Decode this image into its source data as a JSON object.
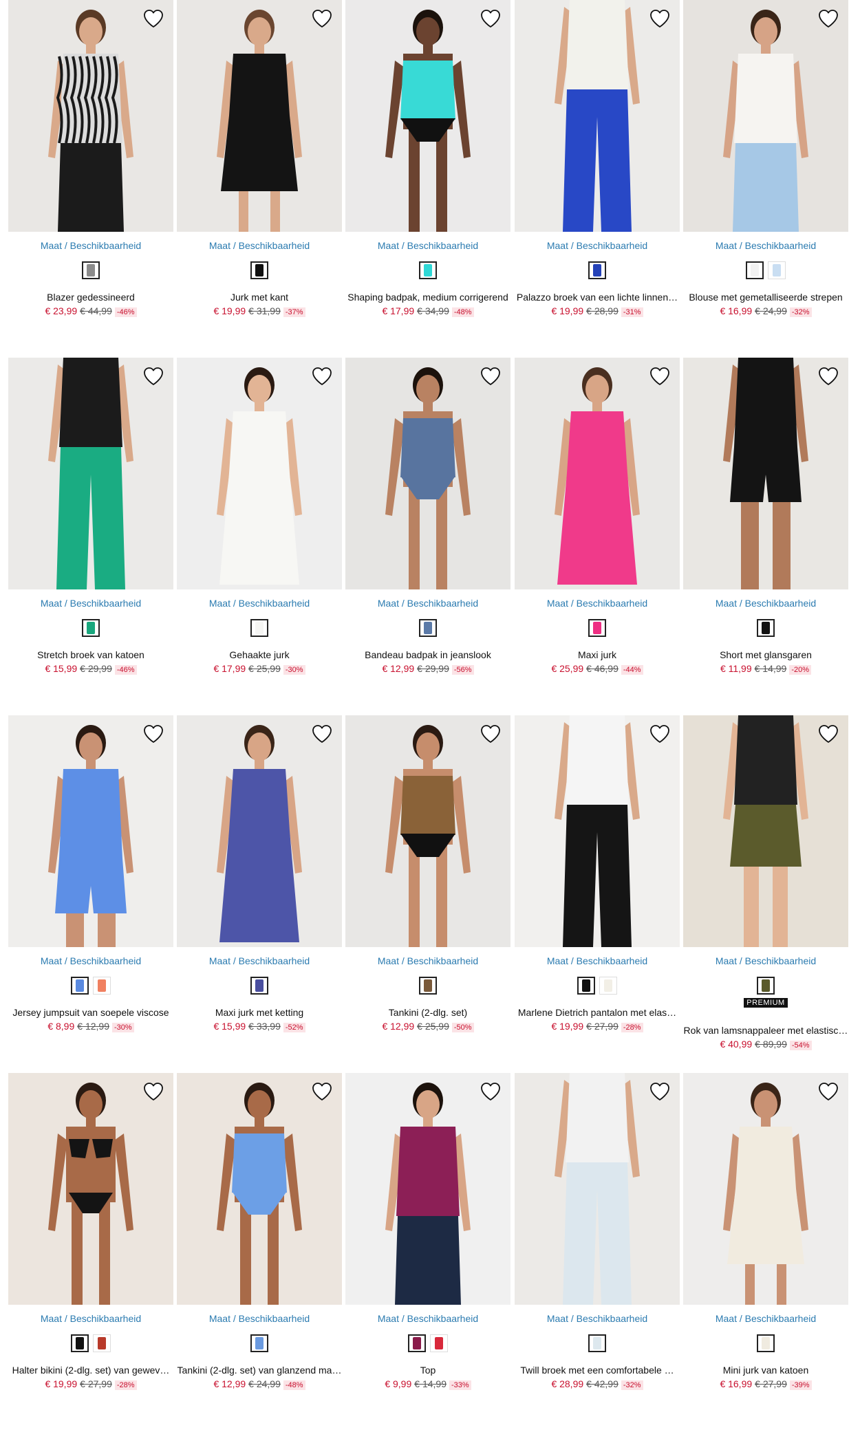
{
  "availability_label": "Maat / Beschikbaarheid",
  "premium_label": "PREMIUM",
  "rows": [
    [
      {
        "name": "Blazer gedessineerd",
        "price": "€ 23,99",
        "old": "€ 44,99",
        "discount": "-46%",
        "swatches": [
          "#8b8b8b"
        ],
        "scene": {
          "bg": "#e9e7e4",
          "top": "#dcdcdc",
          "pattern": "zebra",
          "bottom": "#1b1b1b",
          "skin": "#d9a98a",
          "hair": "#5a3a25"
        }
      },
      {
        "name": "Jurk met kant",
        "price": "€ 19,99",
        "old": "€ 31,99",
        "discount": "-37%",
        "swatches": [
          "#111111"
        ],
        "scene": {
          "bg": "#e9e7e4",
          "top": "#141414",
          "bottom": "#141414",
          "skin": "#d9a98a",
          "hair": "#6a4630",
          "dress": true
        }
      },
      {
        "name": "Shaping badpak, medium corrigerend",
        "price": "€ 17,99",
        "old": "€ 34,99",
        "discount": "-48%",
        "swatches": [
          "#2fd8d6"
        ],
        "scene": {
          "bg": "#ebeaea",
          "top": "#38dad6",
          "bottom": "#111111",
          "skin": "#6b4330",
          "hair": "#1b120c",
          "swim": true
        }
      },
      {
        "name": "Palazzo broek van een lichte linnen…",
        "price": "€ 19,99",
        "old": "€ 28,99",
        "discount": "-31%",
        "swatches": [
          "#2442b8"
        ],
        "scene": {
          "bg": "#ecebe9",
          "top": "#f2f2ec",
          "bottom": "#2848c6",
          "skin": "#d9a98a",
          "hair": "#5a3a25",
          "pants": true,
          "nohead": true
        }
      },
      {
        "name": "Blouse met gemetalliseerde strepen",
        "price": "€ 16,99",
        "old": "€ 24,99",
        "discount": "-32%",
        "swatches": [
          "#f2f2f2",
          "#c9def2"
        ],
        "scene": {
          "bg": "#e6e3df",
          "top": "#f6f4f1",
          "bottom": "#a6c8e6",
          "skin": "#d6a386",
          "hair": "#3a2518"
        }
      }
    ],
    [
      {
        "name": "Stretch broek van katoen",
        "price": "€ 15,99",
        "old": "€ 29,99",
        "discount": "-46%",
        "swatches": [
          "#19a77d"
        ],
        "scene": {
          "bg": "#ebeae8",
          "top": "#1b1b1b",
          "bottom": "#1aac82",
          "skin": "#d9a98a",
          "hair": "#5a3a25",
          "pants": true,
          "nohead": true
        }
      },
      {
        "name": "Gehaakte jurk",
        "price": "€ 17,99",
        "old": "€ 25,99",
        "discount": "-30%",
        "swatches": [
          "#f5f5f3"
        ],
        "scene": {
          "bg": "#eeeeee",
          "top": "#f7f7f4",
          "bottom": "#f7f7f4",
          "skin": "#e2b495",
          "hair": "#2a1a12",
          "dress": true,
          "long": true
        }
      },
      {
        "name": "Bandeau badpak in jeanslook",
        "price": "€ 12,99",
        "old": "€ 29,99",
        "discount": "-56%",
        "swatches": [
          "#5b7aa8"
        ],
        "scene": {
          "bg": "#e6e5e3",
          "top": "#58749f",
          "bottom": "#58749f",
          "skin": "#b98262",
          "hair": "#1c120c",
          "swim": true
        }
      },
      {
        "name": "Maxi jurk",
        "price": "€ 25,99",
        "old": "€ 46,99",
        "discount": "-44%",
        "swatches": [
          "#ee2f83"
        ],
        "scene": {
          "bg": "#e9e8e6",
          "top": "#f03a8a",
          "bottom": "#f03a8a",
          "skin": "#d8a586",
          "hair": "#4a2f20",
          "dress": true,
          "long": true
        }
      },
      {
        "name": "Short met glansgaren",
        "price": "€ 11,99",
        "old": "€ 14,99",
        "discount": "-20%",
        "swatches": [
          "#111111"
        ],
        "scene": {
          "bg": "#e9e7e3",
          "top": "#141414",
          "bottom": "#141414",
          "skin": "#b17a5a",
          "hair": "#2a1a12",
          "shorts": true,
          "nohead": true
        }
      }
    ],
    [
      {
        "name": "Jersey jumpsuit van soepele viscose",
        "price": "€ 8,99",
        "old": "€ 12,99",
        "discount": "-30%",
        "swatches": [
          "#5a8ae0",
          "#f08060"
        ],
        "scene": {
          "bg": "#efeeec",
          "top": "#5d8fe6",
          "bottom": "#5d8fe6",
          "skin": "#c99274",
          "hair": "#2a1a12",
          "shorts": true
        }
      },
      {
        "name": "Maxi jurk met ketting",
        "price": "€ 15,99",
        "old": "€ 33,99",
        "discount": "-52%",
        "swatches": [
          "#4a4fa0"
        ],
        "scene": {
          "bg": "#ebeae8",
          "top": "#4d55a8",
          "bottom": "#4d55a8",
          "skin": "#d8a586",
          "hair": "#3a2518",
          "dress": true,
          "long": true
        }
      },
      {
        "name": "Tankini (2-dlg. set)",
        "price": "€ 12,99",
        "old": "€ 25,99",
        "discount": "-50%",
        "swatches": [
          "#7a5a3a"
        ],
        "scene": {
          "bg": "#e8e7e5",
          "top": "#8a6238",
          "bottom": "#111111",
          "skin": "#c68d6c",
          "hair": "#2a1a12",
          "swim": true
        }
      },
      {
        "name": "Marlene Dietrich pantalon met elas…",
        "price": "€ 19,99",
        "old": "€ 27,99",
        "discount": "-28%",
        "swatches": [
          "#111111",
          "#f2efe6"
        ],
        "scene": {
          "bg": "#f1f0ee",
          "top": "#f5f5f5",
          "bottom": "#151515",
          "skin": "#d9a98a",
          "hair": "#5a3a25",
          "pants": true,
          "nohead": true
        }
      },
      {
        "name": "Rok van lamsnappaleer met elastisc…",
        "price": "€ 40,99",
        "old": "€ 89,99",
        "discount": "-54%",
        "swatches": [
          "#5a5a2a"
        ],
        "premium": true,
        "scene": {
          "bg": "#e6e0d6",
          "top": "#222222",
          "bottom": "#5b5b2c",
          "skin": "#e2b495",
          "hair": "#5a3a25",
          "skirt": true,
          "nohead": true
        }
      }
    ],
    [
      {
        "name": "Halter bikini (2-dlg. set) van gewev…",
        "price": "€ 19,99",
        "old": "€ 27,99",
        "discount": "-28%",
        "swatches": [
          "#111111",
          "#b83a2a"
        ],
        "scene": {
          "bg": "#ece5de",
          "top": "#141414",
          "bottom": "#141414",
          "skin": "#a86a48",
          "hair": "#2a1a12",
          "swim": true,
          "bikini": true
        }
      },
      {
        "name": "Tankini (2-dlg. set) van glanzend ma…",
        "price": "€ 12,99",
        "old": "€ 24,99",
        "discount": "-48%",
        "swatches": [
          "#6a9ae0"
        ],
        "scene": {
          "bg": "#ece5de",
          "top": "#6c9fe6",
          "bottom": "#6c9fe6",
          "skin": "#a86a48",
          "hair": "#2a1a12",
          "swim": true
        }
      },
      {
        "name": "Top",
        "price": "€ 9,99",
        "old": "€ 14,99",
        "discount": "-33%",
        "swatches": [
          "#8a1a4a",
          "#d8283a"
        ],
        "scene": {
          "bg": "#f0f0f0",
          "top": "#8c1f56",
          "bottom": "#1d2a44",
          "skin": "#d8a586",
          "hair": "#1c120c"
        }
      },
      {
        "name": "Twill broek met een comfortabele …",
        "price": "€ 28,99",
        "old": "€ 42,99",
        "discount": "-32%",
        "swatches": [
          "#dde8ee"
        ],
        "scene": {
          "bg": "#eceae7",
          "top": "#f2f2f2",
          "bottom": "#dce7ee",
          "skin": "#d9a98a",
          "hair": "#5a3a25",
          "pants": true,
          "nohead": true
        }
      },
      {
        "name": "Mini jurk van katoen",
        "price": "€ 16,99",
        "old": "€ 27,99",
        "discount": "-39%",
        "swatches": [
          "#f0ebe0"
        ],
        "scene": {
          "bg": "#eeedec",
          "top": "#f1ebdf",
          "bottom": "#f1ebdf",
          "skin": "#c99274",
          "hair": "#3a2518",
          "dress": true
        }
      }
    ]
  ]
}
